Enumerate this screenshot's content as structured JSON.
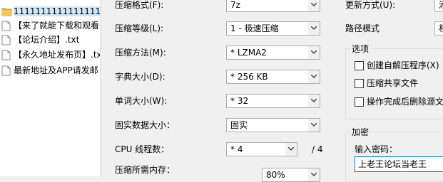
{
  "files": [
    {
      "name": "11111111111111111",
      "icon": "folder-icon",
      "selected": true
    },
    {
      "name": "【来了就能下载和观看",
      "icon": "document-icon",
      "selected": false
    },
    {
      "name": "【论坛介绍】.txt",
      "icon": "document-icon",
      "selected": false
    },
    {
      "name": "【永久地址发布页】.tx",
      "icon": "document-icon",
      "selected": false
    },
    {
      "name": "最新地址及APP请发邮",
      "icon": "document-icon",
      "selected": false
    }
  ],
  "options": {
    "format_label": "压缩格式(F):",
    "format_value": "7z",
    "level_label": "压缩等级(L):",
    "level_value": "1 - 极速压缩",
    "method_label": "压缩方法(M):",
    "method_value": "* LZMA2",
    "dict_label": "字典大小(D):",
    "dict_value": "* 256 KB",
    "word_label": "单词大小(W):",
    "word_value": "* 32",
    "solid_label": "固实数据大小：",
    "solid_value": "固实",
    "cpu_label": "CPU 线程数：",
    "cpu_value": "* 4",
    "cpu_total": "/ 4",
    "memory_label": "压缩所需内存：",
    "memory_value": "80%"
  },
  "right": {
    "update_label": "更新方式(U):",
    "update_value": "添",
    "path_label": "路径模式",
    "path_value": "相",
    "options_group_title": "选项",
    "sfx_label": "创建自解压程序(X)",
    "shared_label": "压缩共享文件",
    "delete_label": "操作完成后删除源文",
    "encryption_title": "加密",
    "password_label": "输入密码：",
    "password_value": "上老王论坛当老王"
  },
  "colors": {
    "selection": "#cce8ff",
    "focus_border": "#0078d7",
    "folder": "#e8b33b"
  }
}
